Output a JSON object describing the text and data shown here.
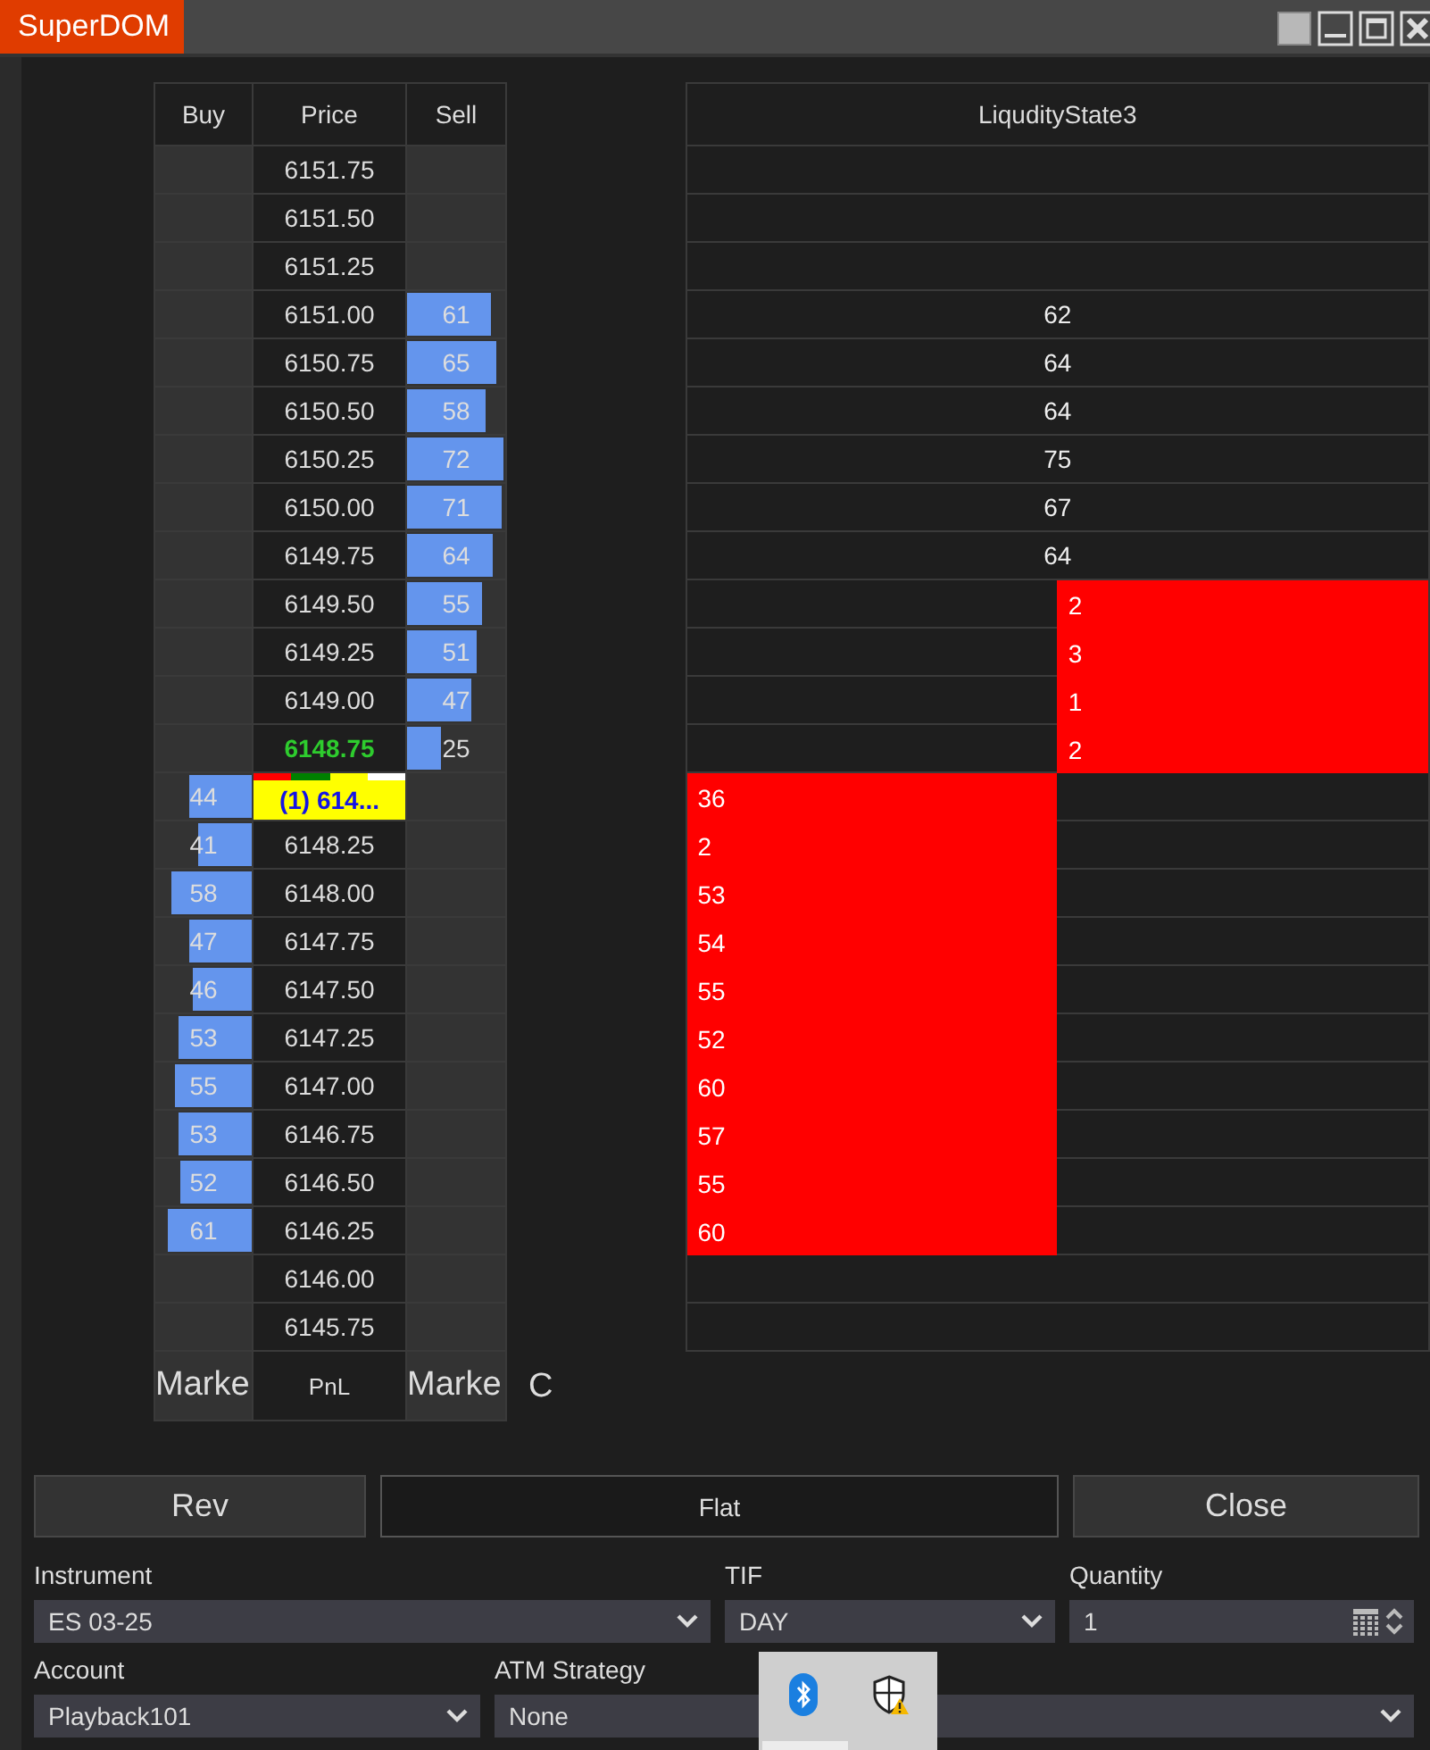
{
  "window": {
    "title": "SuperDOM"
  },
  "ladder": {
    "columns": [
      "Buy",
      "Price",
      "Sell"
    ],
    "rows": [
      {
        "price": "6151.75",
        "kind": "normal",
        "buy": null,
        "sell": null
      },
      {
        "price": "6151.50",
        "kind": "normal",
        "buy": null,
        "sell": null
      },
      {
        "price": "6151.25",
        "kind": "normal",
        "buy": null,
        "sell": null
      },
      {
        "price": "6151.00",
        "kind": "normal",
        "buy": null,
        "sell": {
          "value": "61",
          "level": 0.85
        }
      },
      {
        "price": "6150.75",
        "kind": "normal",
        "buy": null,
        "sell": {
          "value": "65",
          "level": 0.9
        }
      },
      {
        "price": "6150.50",
        "kind": "normal",
        "buy": null,
        "sell": {
          "value": "58",
          "level": 0.8
        }
      },
      {
        "price": "6150.25",
        "kind": "normal",
        "buy": null,
        "sell": {
          "value": "72",
          "level": 0.98
        }
      },
      {
        "price": "6150.00",
        "kind": "normal",
        "buy": null,
        "sell": {
          "value": "71",
          "level": 0.97
        }
      },
      {
        "price": "6149.75",
        "kind": "normal",
        "buy": null,
        "sell": {
          "value": "64",
          "level": 0.87
        }
      },
      {
        "price": "6149.50",
        "kind": "normal",
        "buy": null,
        "sell": {
          "value": "55",
          "level": 0.76
        }
      },
      {
        "price": "6149.25",
        "kind": "normal",
        "buy": null,
        "sell": {
          "value": "51",
          "level": 0.7
        }
      },
      {
        "price": "6149.00",
        "kind": "normal",
        "buy": null,
        "sell": {
          "value": "47",
          "level": 0.65
        }
      },
      {
        "price": "6148.75",
        "kind": "last",
        "buy": null,
        "sell": {
          "value": "25",
          "level": 0.34
        }
      },
      {
        "price": "(1) 614...",
        "kind": "position",
        "buy": {
          "value": "44",
          "level": 0.64
        },
        "sell": null
      },
      {
        "price": "6148.25",
        "kind": "normal",
        "buy": {
          "value": "41",
          "level": 0.56
        },
        "sell": null
      },
      {
        "price": "6148.00",
        "kind": "normal",
        "buy": {
          "value": "58",
          "level": 0.84
        },
        "sell": null
      },
      {
        "price": "6147.75",
        "kind": "normal",
        "buy": {
          "value": "47",
          "level": 0.65
        },
        "sell": null
      },
      {
        "price": "6147.50",
        "kind": "normal",
        "buy": {
          "value": "46",
          "level": 0.62
        },
        "sell": null
      },
      {
        "price": "6147.25",
        "kind": "normal",
        "buy": {
          "value": "53",
          "level": 0.76
        },
        "sell": null
      },
      {
        "price": "6147.00",
        "kind": "normal",
        "buy": {
          "value": "55",
          "level": 0.8
        },
        "sell": null
      },
      {
        "price": "6146.75",
        "kind": "normal",
        "buy": {
          "value": "53",
          "level": 0.76
        },
        "sell": null
      },
      {
        "price": "6146.50",
        "kind": "normal",
        "buy": {
          "value": "52",
          "level": 0.74
        },
        "sell": null
      },
      {
        "price": "6146.25",
        "kind": "normal",
        "buy": {
          "value": "61",
          "level": 0.87
        },
        "sell": null
      },
      {
        "price": "6146.00",
        "kind": "normal",
        "buy": null,
        "sell": null
      },
      {
        "price": "6145.75",
        "kind": "normal",
        "buy": null,
        "sell": null
      }
    ],
    "footer": {
      "buy": "Marke",
      "price": "PnL",
      "sell": "Marke",
      "extra": "C"
    }
  },
  "liquidity": {
    "title": "LiqudityState3",
    "rows": [
      {
        "kind": "empty"
      },
      {
        "kind": "empty"
      },
      {
        "kind": "empty"
      },
      {
        "kind": "plain",
        "value": "62"
      },
      {
        "kind": "plain",
        "value": "64"
      },
      {
        "kind": "plain",
        "value": "64"
      },
      {
        "kind": "plain",
        "value": "75"
      },
      {
        "kind": "plain",
        "value": "67"
      },
      {
        "kind": "plain",
        "value": "64"
      },
      {
        "kind": "ask",
        "value": "2"
      },
      {
        "kind": "ask",
        "value": "3"
      },
      {
        "kind": "ask",
        "value": "1"
      },
      {
        "kind": "ask",
        "value": "2"
      },
      {
        "kind": "bid",
        "value": "36"
      },
      {
        "kind": "bid",
        "value": "2"
      },
      {
        "kind": "bid",
        "value": "53"
      },
      {
        "kind": "bid",
        "value": "54"
      },
      {
        "kind": "bid",
        "value": "55"
      },
      {
        "kind": "bid",
        "value": "52"
      },
      {
        "kind": "bid",
        "value": "60"
      },
      {
        "kind": "bid",
        "value": "57"
      },
      {
        "kind": "bid",
        "value": "55"
      },
      {
        "kind": "bid",
        "value": "60"
      },
      {
        "kind": "empty"
      },
      {
        "kind": "empty"
      }
    ]
  },
  "order_panel": {
    "buttons": [
      {
        "label": "Rev",
        "kind": "filled"
      },
      {
        "label": "Flat",
        "kind": "outline"
      },
      {
        "label": "Close",
        "kind": "filled"
      }
    ],
    "fields": [
      {
        "label": "Instrument",
        "value": "ES 03-25",
        "kind": "dropdown"
      },
      {
        "label": "TIF",
        "value": "DAY",
        "kind": "dropdown"
      },
      {
        "label": "Quantity",
        "value": "1",
        "kind": "spinner"
      },
      {
        "label": "Account",
        "value": "Playback101",
        "kind": "dropdown"
      },
      {
        "label": "ATM Strategy",
        "value": "None",
        "kind": "dropdown"
      }
    ]
  }
}
